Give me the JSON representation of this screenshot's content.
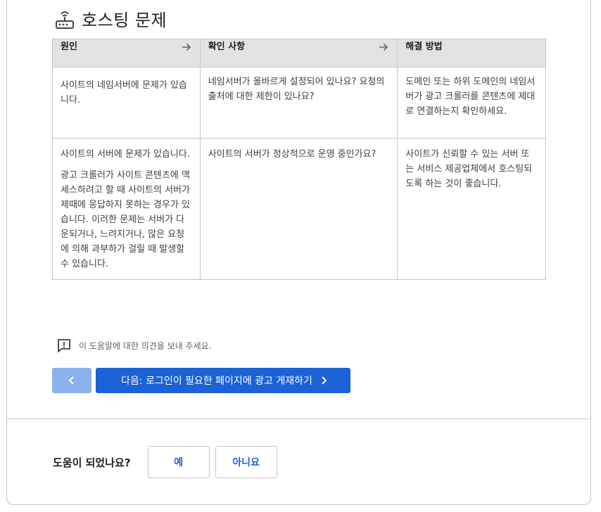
{
  "section": {
    "title": "호스팅 문제",
    "icon": "router-icon"
  },
  "table": {
    "headers": [
      "원인",
      "확인 사항",
      "해결 방법"
    ],
    "rows": [
      {
        "cause": [
          "사이트의 네임서버에 문제가 있습니다."
        ],
        "check": "네임서버가 올바르게 설정되어 있나요? 요청의 출처에 대한 제한이 있나요?",
        "solution": "도메인 또는 하위 도메인의 네임서버가 광고 크롤러를 콘텐츠에 제대로 연결하는지 확인하세요."
      },
      {
        "cause": [
          "사이트의 서버에 문제가 있습니다.",
          "광고 크롤러가 사이트 콘텐츠에 액세스하려고 할 때 사이트의 서버가 제때에 응답하지 못하는 경우가 있습니다. 이러한 문제는 서버가 다운되거나, 느려지거나, 많은 요청에 의해 과부하가 걸릴 때 발생할 수 있습니다."
        ],
        "check": "사이트의 서버가 정상적으로 운영 중인가요?",
        "solution": "사이트가 신뢰할 수 있는 서버 또는 서비스 제공업체에서 호스팅되도록 하는 것이 좋습니다."
      }
    ]
  },
  "feedback": {
    "text": "이 도움말에 대한 의견을 보내 주세요."
  },
  "navigation": {
    "next_label": "다음: 로그인이 필요한 페이지에 광고 게재하기"
  },
  "helpful": {
    "question": "도움이 되었나요?",
    "yes": "예",
    "no": "아니요"
  },
  "colors": {
    "primary": "#1a62d6",
    "prev_disabled": "#8ab1eb",
    "header_bg": "#e3e3e3"
  }
}
